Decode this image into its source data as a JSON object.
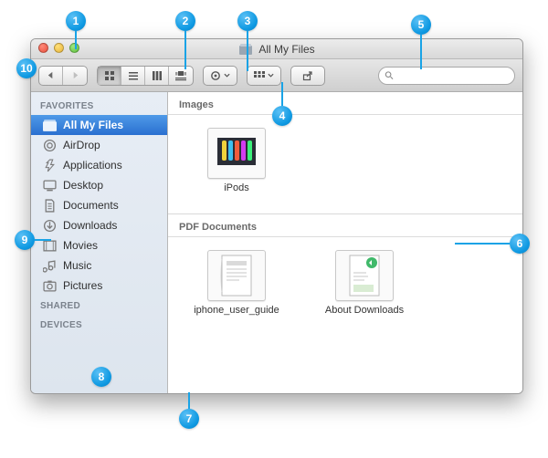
{
  "window": {
    "title": "All My Files"
  },
  "traffic": {
    "close": "close",
    "min": "minimize",
    "max": "zoom"
  },
  "toolbar": {
    "back": "◀",
    "forward": "▶",
    "view_icon": "icon",
    "view_list": "list",
    "view_col": "columns",
    "view_cover": "coverflow",
    "action": "⚙",
    "arrange": "☷",
    "share": "↗"
  },
  "search": {
    "placeholder": ""
  },
  "sidebar": {
    "sections": [
      {
        "title": "FAVORITES",
        "items": [
          {
            "label": "All My Files",
            "icon": "all-my-files-icon",
            "selected": true
          },
          {
            "label": "AirDrop",
            "icon": "airdrop-icon"
          },
          {
            "label": "Applications",
            "icon": "applications-icon"
          },
          {
            "label": "Desktop",
            "icon": "desktop-icon"
          },
          {
            "label": "Documents",
            "icon": "documents-icon"
          },
          {
            "label": "Downloads",
            "icon": "downloads-icon"
          },
          {
            "label": "Movies",
            "icon": "movies-icon"
          },
          {
            "label": "Music",
            "icon": "music-icon"
          },
          {
            "label": "Pictures",
            "icon": "pictures-icon"
          }
        ]
      },
      {
        "title": "SHARED",
        "items": []
      },
      {
        "title": "DEVICES",
        "items": []
      }
    ]
  },
  "content": {
    "groups": [
      {
        "title": "Images",
        "files": [
          {
            "name": "iPods",
            "kind": "image"
          }
        ]
      },
      {
        "title": "PDF Documents",
        "files": [
          {
            "name": "iphone_user_guide",
            "kind": "pdf"
          },
          {
            "name": "About Downloads",
            "kind": "pdf"
          }
        ]
      }
    ]
  },
  "callouts": [
    "1",
    "2",
    "3",
    "4",
    "5",
    "6",
    "7",
    "8",
    "9",
    "10"
  ]
}
